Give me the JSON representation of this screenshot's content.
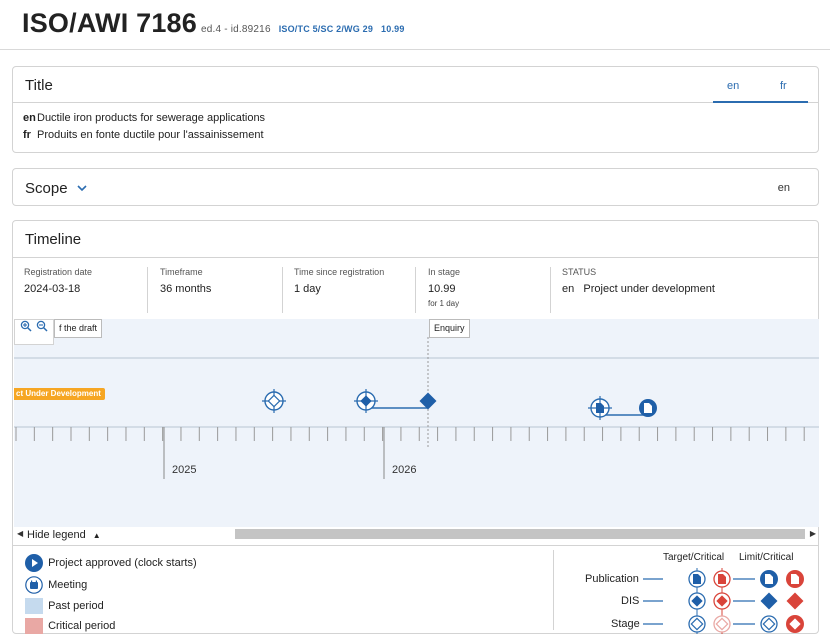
{
  "header": {
    "doc_id": "ISO/AWI 7186",
    "edition": "ed.4 - id.89216",
    "committee": "ISO/TC 5/SC 2/WG 29",
    "stage": "10.99"
  },
  "title_card": {
    "heading": "Title",
    "tabs": [
      "en",
      "fr"
    ],
    "rows": [
      {
        "lang": "en",
        "text": "Ductile iron products for sewerage applications"
      },
      {
        "lang": "fr",
        "text": "Produits en fonte ductile pour l'assainissement"
      }
    ]
  },
  "scope_card": {
    "heading": "Scope",
    "lang": "en"
  },
  "timeline_card": {
    "heading": "Timeline",
    "info": {
      "registration_label": "Registration date",
      "registration_value": "2024-03-18",
      "timeframe_label": "Timeframe",
      "timeframe_value": "36 months",
      "since_label": "Time since registration",
      "since_value": "1 day",
      "instage_label": "In stage",
      "instage_value": "10.99",
      "instage_sub": "for 1 day",
      "status_label": "STATUS",
      "status_lang": "en",
      "status_value": "Project under development"
    },
    "chart": {
      "tags": [
        "f the draft",
        "Enquiry"
      ],
      "status_pill": "ct Under Development",
      "years": [
        "2025",
        "2026"
      ]
    },
    "hide_legend": "Hide legend",
    "legend": {
      "items": [
        {
          "label": "Project approved (clock starts)",
          "icon": "play-icon"
        },
        {
          "label": "Meeting",
          "icon": "calendar-icon"
        },
        {
          "label": "Past period",
          "color": "#c5daee"
        },
        {
          "label": "Critical period",
          "color": "#e9a8a4"
        }
      ],
      "target_critical": "Target/Critical",
      "limit_critical": "Limit/Critical",
      "rows": [
        "Publication",
        "DIS",
        "Stage"
      ]
    }
  },
  "colors": {
    "accent": "#2b6cb0",
    "critical": "#d9443a",
    "status": "#f6a623"
  }
}
